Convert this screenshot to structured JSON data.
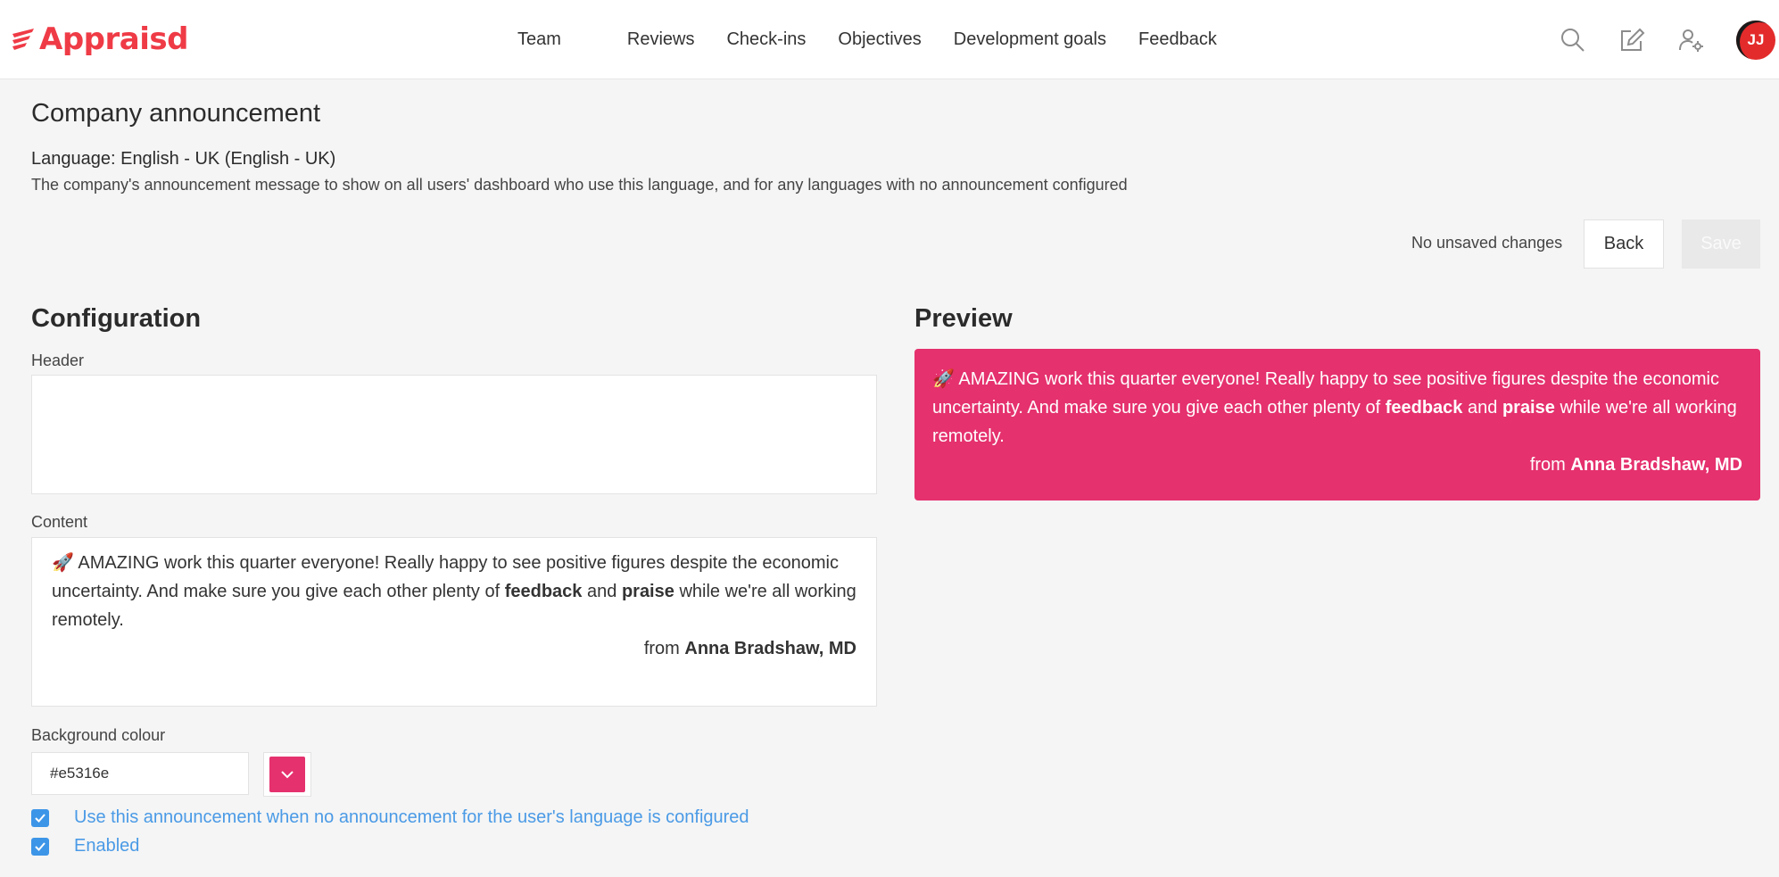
{
  "brand": {
    "name": "Appraisd",
    "accent": "#ef3b46"
  },
  "nav": {
    "items": [
      "Team",
      "Reviews",
      "Check-ins",
      "Objectives",
      "Development goals",
      "Feedback"
    ],
    "icons": [
      "search-icon",
      "edit-icon",
      "user-settings-icon"
    ],
    "avatar_initials": "JJ"
  },
  "page": {
    "title": "Company announcement",
    "language_label": "Language: English - UK (English - UK)",
    "language_description": "The company's announcement message to show on all users' dashboard who use this language, and for any languages with no announcement configured",
    "status": "No unsaved changes",
    "back_label": "Back",
    "save_label": "Save"
  },
  "config": {
    "title": "Configuration",
    "header_label": "Header",
    "header_value": "",
    "content_label": "Content",
    "background_label": "Background colour",
    "background_value": "#e5316e",
    "options": [
      {
        "label": "Use this announcement when no announcement for the user's language is configured",
        "checked": true
      },
      {
        "label": "Enabled",
        "checked": true
      }
    ]
  },
  "announcement": {
    "emoji": "🚀",
    "text_1": "AMAZING work this quarter everyone! Really happy to see positive figures despite the economic uncertainty. And make sure you give each other plenty of",
    "bold_1": "feedback",
    "text_2": "and",
    "bold_2": "praise",
    "text_3": "while we're all working remotely.",
    "from_prefix": "from",
    "from_name": "Anna Bradshaw, MD"
  },
  "preview": {
    "title": "Preview"
  },
  "colors": {
    "preview_bg": "#e5316e",
    "link": "#4a9ae6",
    "checkbox": "#3d95e8"
  }
}
